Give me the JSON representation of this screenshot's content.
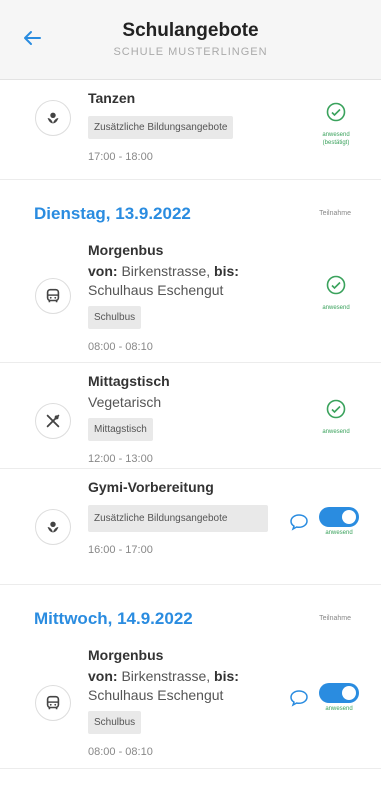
{
  "header": {
    "title": "Schulangebote",
    "subtitle": "SCHULE MUSTERLINGEN"
  },
  "items_top": {
    "tanzen": {
      "title": "Tanzen",
      "tag": "Zusätzliche Bildungsangebote",
      "time": "17:00 - 18:00",
      "status_line1": "anwesend",
      "status_line2": "(bestätigt)"
    }
  },
  "day1": {
    "title": "Dienstag, 13.9.2022",
    "column": "Teilnahme",
    "morgenbus": {
      "title": "Morgenbus",
      "from_label": "von:",
      "from": "Birkenstrasse,",
      "to_label": "bis:",
      "to": "Schulhaus Eschengut",
      "tag": "Schulbus",
      "time": "08:00 - 08:10",
      "status": "anwesend"
    },
    "mittag": {
      "title": "Mittagstisch",
      "subtitle": "Vegetarisch",
      "tag": "Mittagstisch",
      "time": "12:00 - 13:00",
      "status": "anwesend"
    },
    "gymi": {
      "title": "Gymi-Vorbereitung",
      "tag": "Zusätzliche Bildungsangebote",
      "time": "16:00 - 17:00",
      "status": "anwesend"
    }
  },
  "day2": {
    "title": "Mittwoch, 14.9.2022",
    "column": "Teilnahme",
    "morgenbus": {
      "title": "Morgenbus",
      "from_label": "von:",
      "from": "Birkenstrasse,",
      "to_label": "bis:",
      "to": "Schulhaus Eschengut",
      "tag": "Schulbus",
      "time": "08:00 - 08:10",
      "status": "anwesend"
    }
  },
  "icons": {
    "back": "arrow-left-icon",
    "activity": "flower-icon",
    "bus": "bus-icon",
    "meal": "cutlery-icon",
    "check": "check-circle-icon",
    "chat": "chat-bubble-icon"
  },
  "colors": {
    "accent": "#2a8ce0",
    "success": "#3aa25c"
  },
  "toggles": {
    "gymi_on": true,
    "morgenbus_day2_on": true
  }
}
